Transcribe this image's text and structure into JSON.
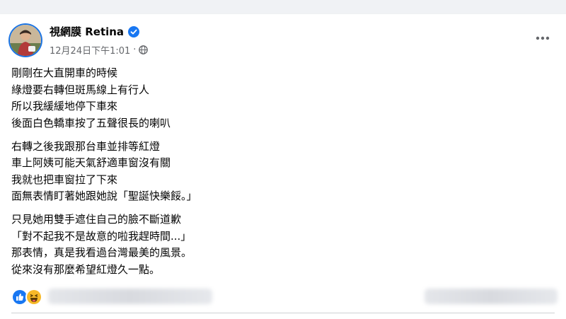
{
  "post": {
    "author_name": "視網膜 Retina",
    "timestamp": "12月24日下午1:01",
    "separator": "·",
    "paragraphs": [
      [
        "剛剛在大直開車的時候",
        "綠燈要右轉但斑馬線上有行人",
        "所以我緩緩地停下車來",
        "後面白色轎車按了五聲很長的喇叭"
      ],
      [
        "右轉之後我跟那台車並排等紅燈",
        "車上阿姨可能天氣舒適車窗沒有關",
        "我就也把車窗拉了下來",
        "面無表情盯著她跟她說「聖誕快樂餒。」"
      ],
      [
        "只見她用雙手遮住自己的臉不斷道歉",
        "「對不起我不是故意的啦我趕時間...」",
        "那表情，真是我看過台灣最美的風景。",
        "從來沒有那麼希望紅燈久一點。"
      ]
    ]
  },
  "icons": {
    "avatar": "avatar",
    "verified": "verified-badge-icon",
    "privacy": "globe-icon",
    "more": "more-options-icon",
    "like": "like-reaction-icon",
    "haha": "haha-reaction-icon"
  },
  "colors": {
    "accent": "#1b74e4",
    "text": "#050505",
    "secondary": "#65676b",
    "background": "#f0f2f5",
    "like": "#1877f2",
    "haha": "#f7b928"
  }
}
